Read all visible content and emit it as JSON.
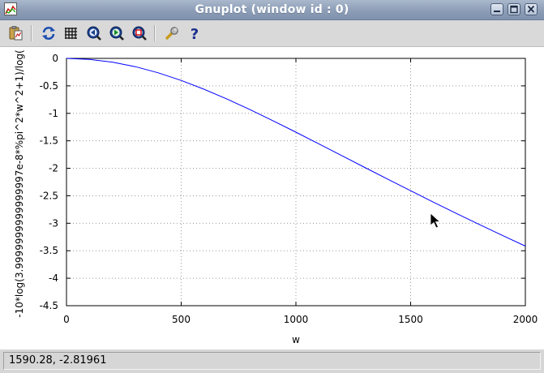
{
  "window": {
    "title": "Gnuplot (window id : 0)",
    "buttons": [
      "minimize",
      "maximize",
      "close"
    ]
  },
  "toolbar": {
    "items": [
      {
        "icon": "copy-clipboard-icon"
      },
      {
        "icon": "replot-icon"
      },
      {
        "icon": "grid-icon"
      },
      {
        "icon": "zoom-previous-icon"
      },
      {
        "icon": "zoom-next-icon"
      },
      {
        "icon": "zoom-autoscale-icon"
      },
      {
        "icon": "settings-wrench-icon"
      },
      {
        "icon": "help-icon"
      }
    ]
  },
  "status": {
    "coordinates": "1590.28, -2.81961"
  },
  "chart_data": {
    "type": "line",
    "xlabel": "w",
    "ylabel": "-10*log(3.9999999999999997e-8*%pi^2*w^2+1)/log(",
    "xlim": [
      0,
      2000
    ],
    "ylim": [
      -4.5,
      0
    ],
    "xticks": [
      "0",
      "500",
      "1000",
      "1500",
      "2000"
    ],
    "yticks": [
      "0",
      "-0.5",
      "-1",
      "-1.5",
      "-2",
      "-2.5",
      "-3",
      "-3.5",
      "-4",
      "-4.5"
    ],
    "grid": true,
    "series": [
      {
        "color": "#0000ff",
        "x": [
          0,
          100,
          200,
          300,
          400,
          500,
          600,
          700,
          800,
          900,
          1000,
          1100,
          1200,
          1300,
          1400,
          1500,
          1600,
          1700,
          1800,
          1900,
          2000
        ],
        "y": [
          0,
          -0.017,
          -0.068,
          -0.151,
          -0.263,
          -0.401,
          -0.562,
          -0.74,
          -0.932,
          -1.134,
          -1.342,
          -1.555,
          -1.769,
          -1.984,
          -2.197,
          -2.408,
          -2.617,
          -2.822,
          -3.023,
          -3.221,
          -3.415
        ]
      }
    ]
  }
}
